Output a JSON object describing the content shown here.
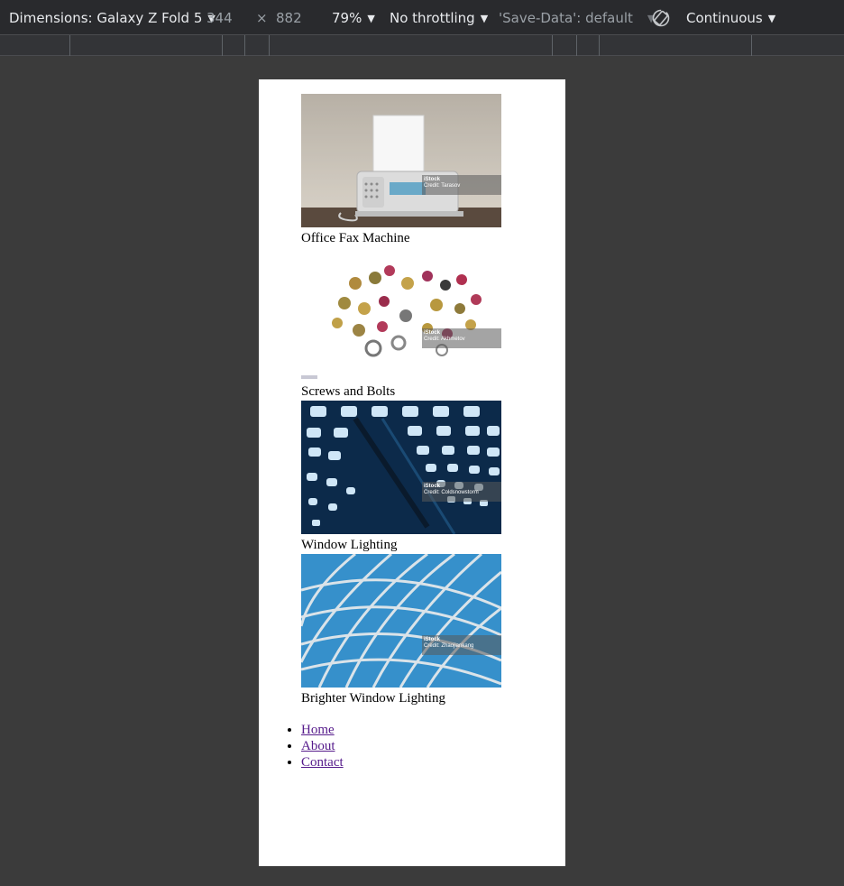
{
  "devtools": {
    "dimensions_label": "Dimensions: Galaxy Z Fold 5",
    "width": "344",
    "times": "×",
    "height": "882",
    "zoom": "79%",
    "throttling": "No throttling",
    "save_data": "'Save-Data': default",
    "mode": "Continuous",
    "icons": {
      "caret": "chevron-down-icon",
      "rotate": "rotate-icon"
    }
  },
  "page": {
    "cards": [
      {
        "caption": "Office Fax Machine",
        "watermark": "iStock",
        "watermark_sub": "Credit: Tarasov"
      },
      {
        "caption": "Screws and Bolts",
        "watermark": "iStock",
        "watermark_sub": "Credit: Akhmetov"
      },
      {
        "caption": "Window Lighting",
        "watermark": "iStock",
        "watermark_sub": "Credit: Coldsnowstorm"
      },
      {
        "caption": "Brighter Window Lighting",
        "watermark": "iStock",
        "watermark_sub": "Credit: Zhaojiankang"
      }
    ],
    "nav": [
      {
        "label": "Home"
      },
      {
        "label": "About"
      },
      {
        "label": "Contact"
      }
    ]
  },
  "colors": {
    "link_visited": "#551a8b",
    "toolbar_bg": "#292a2d",
    "viewport_bg": "#3b3b3b"
  }
}
